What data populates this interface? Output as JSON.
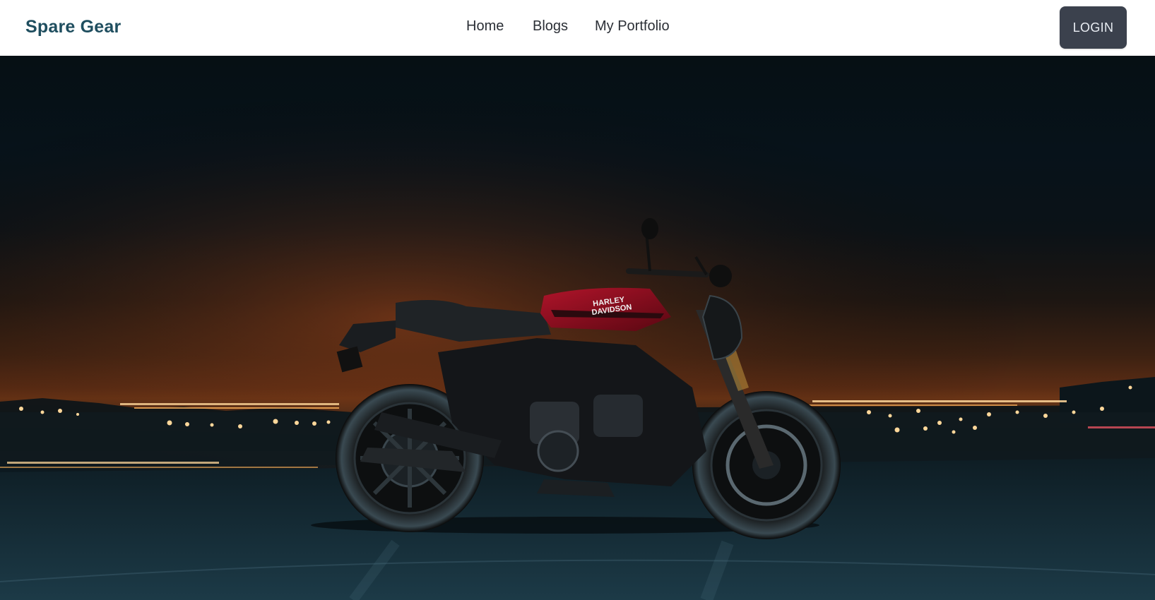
{
  "navbar": {
    "brand": "Spare Gear",
    "links": [
      {
        "label": "Home"
      },
      {
        "label": "Blogs"
      },
      {
        "label": "My Portfolio"
      }
    ],
    "login_label": "LOGIN"
  },
  "hero": {
    "image": "motorcycle-at-night-over-city-lights",
    "tank_text_line1": "HARLEY",
    "tank_text_line2": "DAVIDSON"
  },
  "colors": {
    "brand": "#1f4e5f",
    "login_bg": "#3b414d",
    "tank_red": "#8b0d1a"
  }
}
